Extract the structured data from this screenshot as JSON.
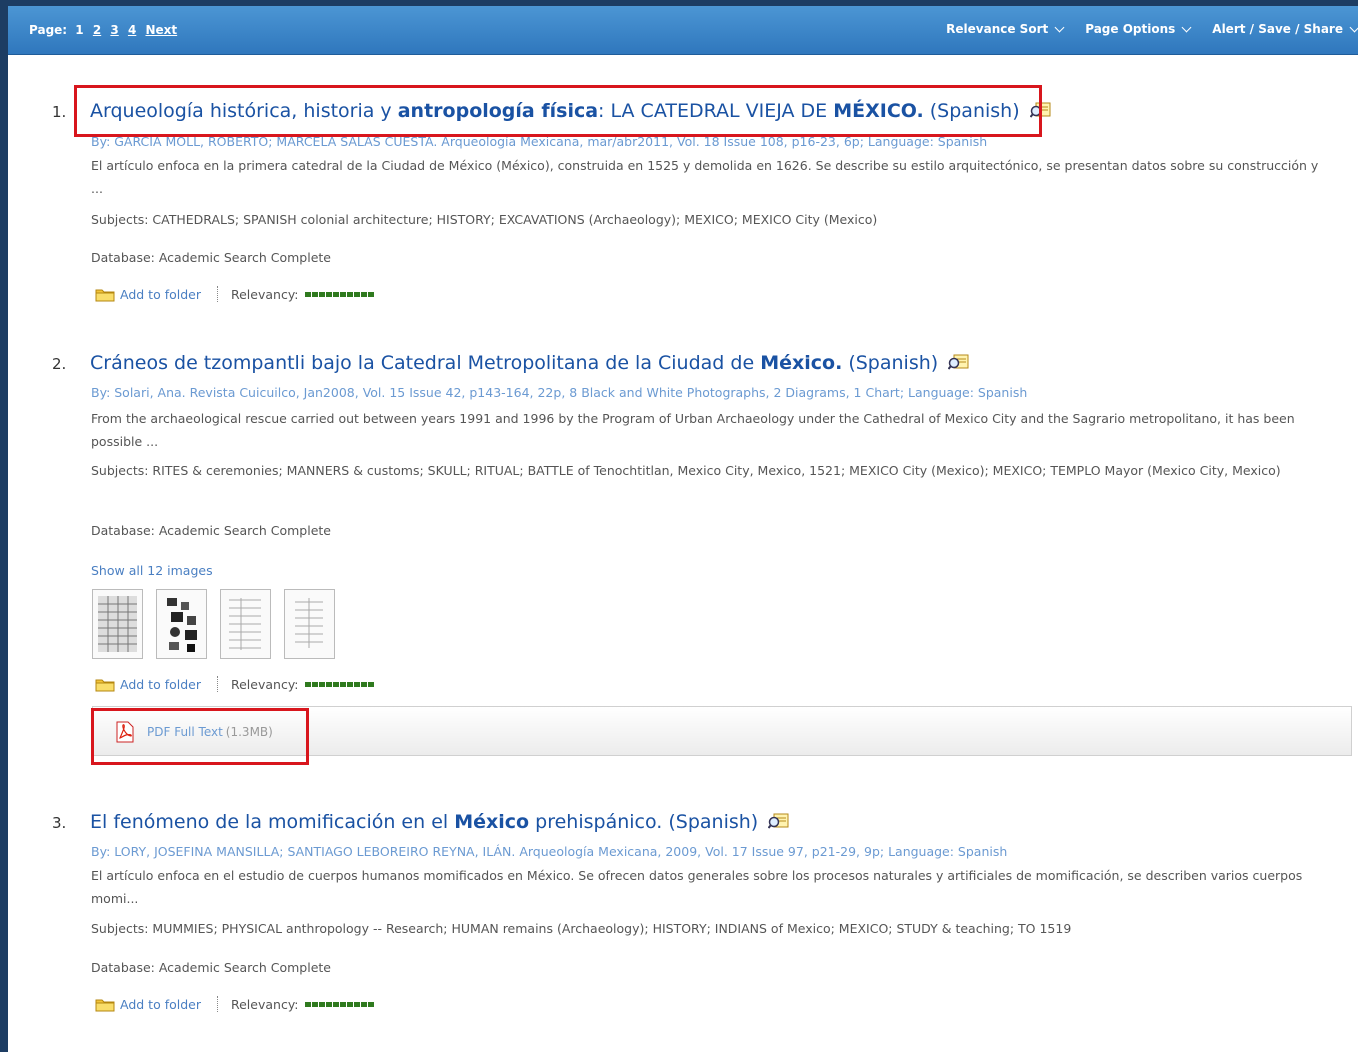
{
  "toolbar": {
    "page_label": "Page:",
    "pages": [
      "1",
      "2",
      "3",
      "4"
    ],
    "next_label": "Next",
    "relevance_sort": "Relevance Sort",
    "page_options": "Page Options",
    "alert_save_share": "Alert / Save / Share"
  },
  "results": [
    {
      "number": "1.",
      "title_parts": [
        "Arqueología histórica, historia y ",
        "antropología física",
        ": LA CATEDRAL VIEJA DE ",
        "MÉXICO.",
        " (Spanish)"
      ],
      "byline": "By: GARCÍA MOLL, ROBERTO; MARCELA SALAS CUESTA. Arqueología Mexicana, mar/abr2011, Vol. 18 Issue 108, p16-23, 6p; Language: Spanish",
      "abstract": "El artículo enfoca en la primera catedral de la Ciudad de México (México), construida en 1525 y demolida en 1626. Se describe su estilo arquitectónico, se presentan datos sobre su construcción y ...",
      "subjects": "Subjects: CATHEDRALS; SPANISH colonial architecture; HISTORY; EXCAVATIONS (Archaeology); MEXICO; MEXICO City (Mexico)",
      "database": "Database: Academic Search Complete",
      "add_to_folder": "Add to folder",
      "relevancy_label": "Relevancy:",
      "relevancy": 1.0
    },
    {
      "number": "2.",
      "title_parts": [
        "Cráneos de tzompantli bajo la Catedral Metropolitana de la Ciudad de ",
        "México.",
        " (Spanish)"
      ],
      "byline": "By: Solari, Ana. Revista Cuicuilco, Jan2008, Vol. 15 Issue 42, p143-164, 22p, 8 Black and White Photographs, 2 Diagrams, 1 Chart; Language: Spanish",
      "abstract": "From the archaeological rescue carried out between years 1991 and 1996 by the Program of Urban Archaeology under the Cathedral of Mexico City and the Sagrario metropolitano, it has been possible ...",
      "subjects": "Subjects: RITES & ceremonies; MANNERS & customs; SKULL; RITUAL; BATTLE of Tenochtitlan, Mexico City, Mexico, 1521; MEXICO City (Mexico); MEXICO; TEMPLO Mayor (Mexico City, Mexico)",
      "database": "Database: Academic Search Complete",
      "show_images": "Show all 12 images",
      "add_to_folder": "Add to folder",
      "relevancy_label": "Relevancy:",
      "relevancy": 1.0,
      "pdf_label": "PDF Full Text",
      "pdf_size": "(1.3MB)"
    },
    {
      "number": "3.",
      "title_parts": [
        "El fenómeno de la momificación en el ",
        "México",
        " prehispánico. (Spanish)"
      ],
      "byline": "By: LORY, JOSEFINA MANSILLA; SANTIAGO LEBOREIRO REYNA, ILÁN. Arqueología Mexicana, 2009, Vol. 17 Issue 97, p21-29, 9p; Language: Spanish",
      "abstract": "El artículo enfoca en el estudio de cuerpos humanos momificados en México. Se ofrecen datos generales sobre los procesos naturales y artificiales de momificación, se describen varios cuerpos momi...",
      "subjects": "Subjects: MUMMIES; PHYSICAL anthropology -- Research; HUMAN remains (Archaeology); HISTORY; INDIANS of Mexico; MEXICO; STUDY & teaching; TO 1519",
      "database": "Database: Academic Search Complete",
      "add_to_folder": "Add to folder",
      "relevancy_label": "Relevancy:",
      "relevancy": 1.0
    }
  ],
  "icons": {
    "view": "magnifier-document-icon",
    "folder": "folder-icon",
    "pdf": "pdf-icon"
  },
  "colors": {
    "toolbar": "#3b86c8",
    "link": "#1a52a3",
    "highlight_box": "#d8161d",
    "relevancy": "#2f7a1e"
  }
}
